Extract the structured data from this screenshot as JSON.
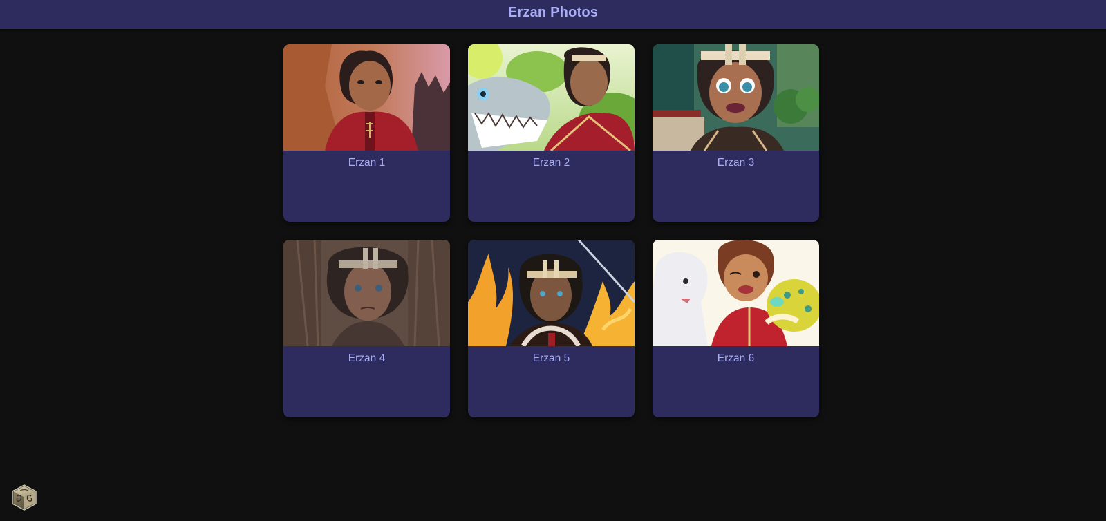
{
  "header": {
    "title": "Erzan Photos"
  },
  "photos": [
    {
      "caption": "Erzan 1",
      "scene": "canyon-sunset"
    },
    {
      "caption": "Erzan 2",
      "scene": "dragon-meadow"
    },
    {
      "caption": "Erzan 3",
      "scene": "garden-pavilion"
    },
    {
      "caption": "Erzan 4",
      "scene": "stone-hall"
    },
    {
      "caption": "Erzan 5",
      "scene": "fire-night"
    },
    {
      "caption": "Erzan 6",
      "scene": "friends-hug"
    }
  ],
  "corner_badge": {
    "icon": "cube-emblem-icon"
  },
  "colors": {
    "header_bg": "#2e2c5e",
    "card_bg": "#2e2c5e",
    "accent_text": "#a9acf6",
    "page_bg": "#101010"
  }
}
